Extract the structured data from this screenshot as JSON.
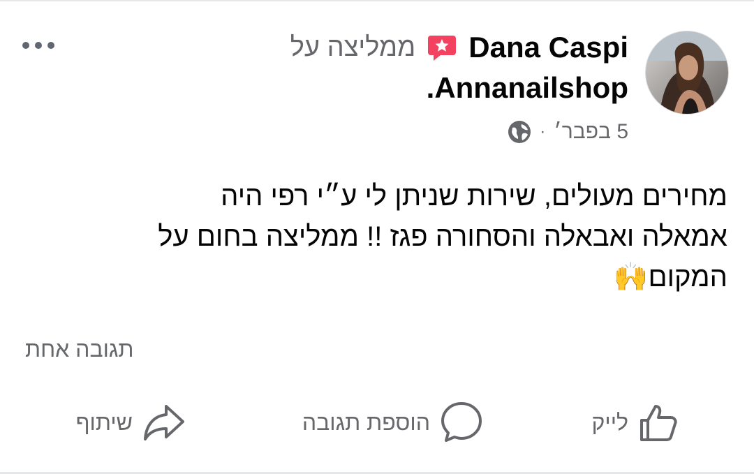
{
  "post": {
    "author": "Dana Caspi",
    "action_text": "ממליצה על",
    "page_name": "Annanailshop.",
    "date": "5 בפבר׳",
    "separator": "·",
    "body_lines": [
      "מחירים מעולים, שירות שניתן לי ע״י רפי היה",
      "אמאלה ואבאלה והסחורה פגז !! ממליצה בחום על",
      "המקום🙌"
    ],
    "comments_count": "תגובה אחת",
    "privacy_icon": "globe-icon",
    "badge_icon": "recommendation-badge-icon"
  },
  "actions": {
    "like": "לייק",
    "comment": "הוספת תגובה",
    "share": "שיתוף"
  },
  "colors": {
    "badge": "#f3425f",
    "text": "#050505",
    "secondary": "#65676b"
  }
}
